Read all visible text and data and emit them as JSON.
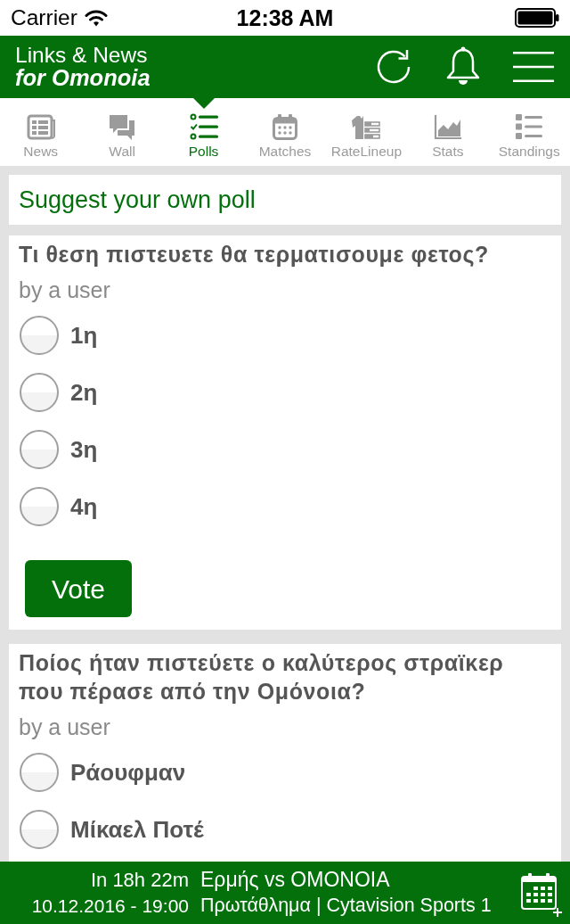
{
  "status_bar": {
    "carrier": "Carrier",
    "time": "12:38 AM"
  },
  "header": {
    "title": "Links & News",
    "subtitle": "for Omonoia"
  },
  "tabs": [
    {
      "label": "News",
      "selected": false
    },
    {
      "label": "Wall",
      "selected": false
    },
    {
      "label": "Polls",
      "selected": true
    },
    {
      "label": "Matches",
      "selected": false
    },
    {
      "label": "RateLineup",
      "selected": false
    },
    {
      "label": "Stats",
      "selected": false
    },
    {
      "label": "Standings",
      "selected": false
    }
  ],
  "suggest_link": "Suggest your own poll",
  "polls": [
    {
      "question": "Τι θεση πιστευετε θα τερματισουμε φετος?",
      "author": "by a user",
      "options": [
        {
          "label": "1η",
          "selected": false
        },
        {
          "label": "2η",
          "selected": false
        },
        {
          "label": "3η",
          "selected": false
        },
        {
          "label": "4η",
          "selected": false
        }
      ],
      "button": "Vote"
    },
    {
      "question": "Ποίος ήταν πιστεύετε ο καλύτερος στραϊκερ που πέρασε από την Ομόνοια?",
      "author": "by a user",
      "options": [
        {
          "label": "Ράουφμαν",
          "selected": false
        },
        {
          "label": "Μίκαελ Ποτέ",
          "selected": false
        }
      ]
    }
  ],
  "next_match": {
    "countdown": "In 18h 22m",
    "datetime": "10.12.2016 - 19:00",
    "teams": "Ερμής vs ΟΜΟΝΟΙΑ",
    "details": "Πρωτάθλημα | Cytavision Sports 1"
  }
}
